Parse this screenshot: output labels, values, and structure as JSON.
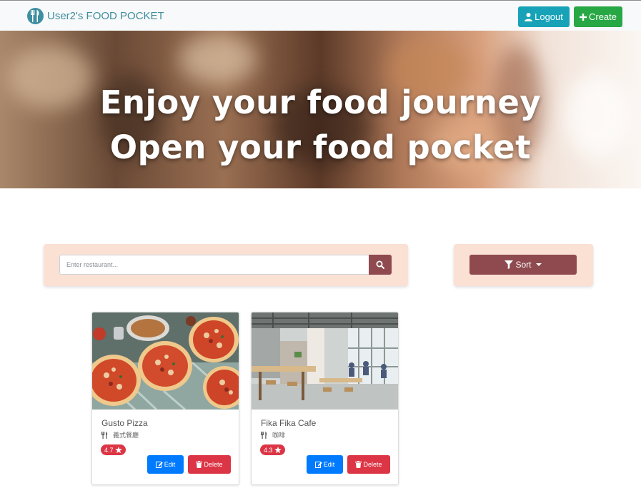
{
  "navbar": {
    "brand": "User2's FOOD POCKET",
    "logout_label": "Logout",
    "create_label": "Create"
  },
  "hero": {
    "line1": "Enjoy your food journey",
    "line2": "Open your food pocket"
  },
  "search": {
    "placeholder": "Enter restaurant..."
  },
  "sort": {
    "label": "Sort"
  },
  "cards": [
    {
      "name": "Gusto Pizza",
      "category": "義式餐廳",
      "rating": "4.7",
      "edit_label": "Edit",
      "delete_label": "Delete",
      "image": "pizza-photo"
    },
    {
      "name": "Fika Fika Cafe",
      "category": "咖啡",
      "rating": "4.3",
      "edit_label": "Edit",
      "delete_label": "Delete",
      "image": "cafe-interior-photo"
    }
  ],
  "colors": {
    "primary": "#007bff",
    "info": "#17a2b8",
    "success": "#28a745",
    "danger": "#dc3545",
    "maroon": "#8f4a4f",
    "panel": "#fbe0d4",
    "brand_text": "#3f8d9e"
  },
  "icons": [
    "utensils-logo-icon",
    "user-icon",
    "plus-icon",
    "search-icon",
    "filter-icon",
    "caret-down-icon",
    "utensils-icon",
    "star-icon",
    "edit-icon",
    "trash-icon"
  ]
}
